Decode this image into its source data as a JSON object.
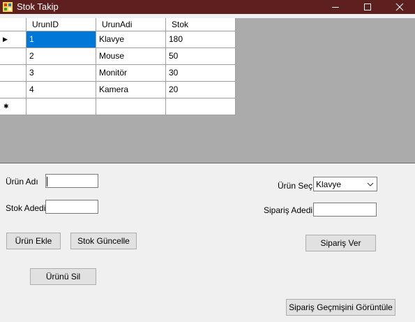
{
  "window": {
    "title": "Stok Takip",
    "titlebar_color": "#5e1f1f"
  },
  "grid": {
    "columns": [
      "UrunID",
      "UrunAdi",
      "Stok"
    ],
    "rows": [
      {
        "UrunID": "1",
        "UrunAdi": "Klavye",
        "Stok": "180"
      },
      {
        "UrunID": "2",
        "UrunAdi": "Mouse",
        "Stok": "50"
      },
      {
        "UrunID": "3",
        "UrunAdi": "Monitör",
        "Stok": "30"
      },
      {
        "UrunID": "4",
        "UrunAdi": "Kamera",
        "Stok": "20"
      }
    ],
    "current_row_marker": "▶",
    "new_row_marker": "✱",
    "selection_color": "#0078d7"
  },
  "form": {
    "urun_adi_label": "Ürün Adı",
    "urun_adi_value": "",
    "stok_adedi_label": "Stok Adedi",
    "stok_adedi_value": "",
    "urun_sec_label": "Ürün Seç",
    "urun_sec_selected": "Klavye",
    "siparis_adedi_label": "Sipariş Adedi",
    "siparis_adedi_value": ""
  },
  "buttons": {
    "urun_ekle": "Ürün Ekle",
    "stok_guncelle": "Stok Güncelle",
    "urunu_sil": "Ürünü Sil",
    "siparis_ver": "Sipariş Ver",
    "siparis_gecmisi": "Sipariş Geçmişini Görüntüle"
  },
  "icons": {
    "app": "app-icon",
    "minimize": "minimize-icon",
    "maximize": "maximize-icon",
    "close": "close-icon",
    "combo": "chevron-down-icon"
  }
}
